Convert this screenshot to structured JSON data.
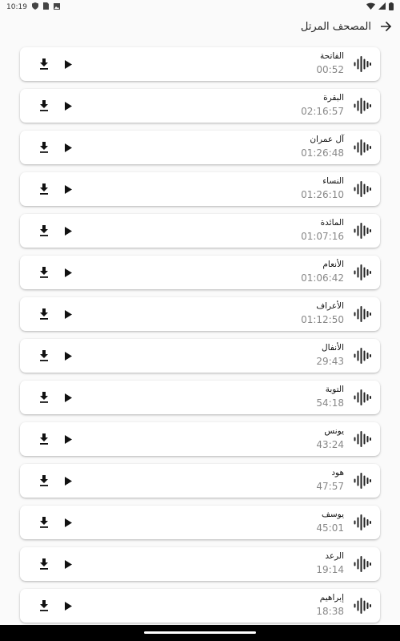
{
  "status_bar": {
    "time": "10:19"
  },
  "app_bar": {
    "title": "المصحف المرتل",
    "back_icon": "arrow-back-icon"
  },
  "surahs": [
    {
      "name": "الفاتحة",
      "duration": "00:52"
    },
    {
      "name": "البقرة",
      "duration": "02:16:57"
    },
    {
      "name": "آل عمران",
      "duration": "01:26:48"
    },
    {
      "name": "النساء",
      "duration": "01:26:10"
    },
    {
      "name": "المائدة",
      "duration": "01:07:16"
    },
    {
      "name": "الأنعام",
      "duration": "01:06:42"
    },
    {
      "name": "الأعراف",
      "duration": "01:12:50"
    },
    {
      "name": "الأنفال",
      "duration": "29:43"
    },
    {
      "name": "التوبة",
      "duration": "54:18"
    },
    {
      "name": "يونس",
      "duration": "43:24"
    },
    {
      "name": "هود",
      "duration": "47:57"
    },
    {
      "name": "يوسف",
      "duration": "45:01"
    },
    {
      "name": "الرعد",
      "duration": "19:14"
    },
    {
      "name": "إبراهيم",
      "duration": "18:38"
    }
  ],
  "icons": {
    "download": "download-icon",
    "play": "play-icon",
    "audio": "audio-wave-icon"
  }
}
